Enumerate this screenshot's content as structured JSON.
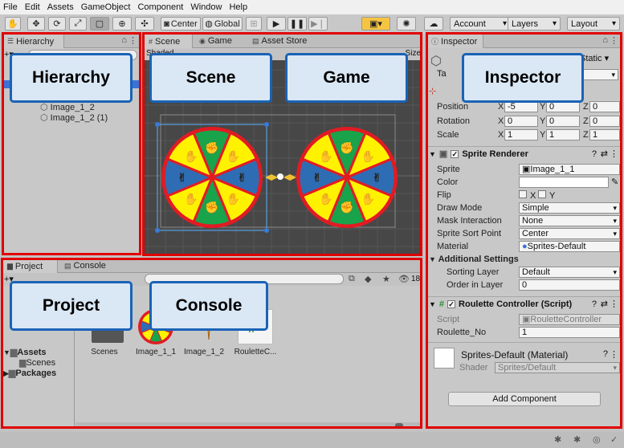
{
  "menu": [
    "File",
    "Edit",
    "Assets",
    "GameObject",
    "Component",
    "Window",
    "Help"
  ],
  "toolbar": {
    "center_label": "Center",
    "global_label": "Global",
    "account_label": "Account",
    "layers_label": "Layers",
    "layout_label": "Layout"
  },
  "hierarchy": {
    "tab": "Hierarchy",
    "items": [
      "Image_1_2",
      "Image_1_2 (1)"
    ]
  },
  "scene_tabs": {
    "scene": "Scene",
    "game": "Game",
    "asset_store": "Asset Store",
    "toolbar_partial": "Shaded",
    "size_partial": "Size"
  },
  "inspector": {
    "tab": "Inspector",
    "static_label": "Static",
    "tag_partial": "Ta",
    "layer_partial": "ult",
    "transform": {
      "position_label": "Position",
      "position": {
        "x": "-5",
        "y": "0",
        "z": "0"
      },
      "rotation_label": "Rotation",
      "rotation": {
        "x": "0",
        "y": "0",
        "z": "0"
      },
      "scale_label": "Scale",
      "scale": {
        "x": "1",
        "y": "1",
        "z": "1"
      }
    },
    "sprite_renderer": {
      "title": "Sprite Renderer",
      "sprite_label": "Sprite",
      "sprite_value": "Image_1_1",
      "color_label": "Color",
      "flip_label": "Flip",
      "flip_x": "X",
      "flip_y": "Y",
      "draw_mode_label": "Draw Mode",
      "draw_mode_value": "Simple",
      "mask_label": "Mask Interaction",
      "mask_value": "None",
      "sort_point_label": "Sprite Sort Point",
      "sort_point_value": "Center",
      "material_label": "Material",
      "material_value": "Sprites-Default",
      "additional_label": "Additional Settings",
      "sorting_layer_label": "Sorting Layer",
      "sorting_layer_value": "Default",
      "order_label": "Order in Layer",
      "order_value": "0"
    },
    "roulette": {
      "title": "Roulette Controller (Script)",
      "script_label": "Script",
      "script_value": "RouletteController",
      "no_label": "Roulette_No",
      "no_value": "1"
    },
    "material": {
      "title": "Sprites-Default (Material)",
      "shader_label": "Shader",
      "shader_value": "Sprites/Default"
    },
    "add_component": "Add Component"
  },
  "project": {
    "tab_project": "Project",
    "tab_console": "Console",
    "tree": [
      "Assets",
      "Scenes",
      "Packages"
    ],
    "assets": [
      "Scenes",
      "Image_1_1",
      "Image_1_2",
      "RouletteC..."
    ],
    "count_badge": "18"
  },
  "callouts": {
    "hierarchy": "Hierarchy",
    "scene": "Scene",
    "game": "Game",
    "inspector": "Inspector",
    "project": "Project",
    "console": "Console"
  },
  "colors": {
    "highlight_red": "#e00000",
    "callout_border": "#1a63b5",
    "callout_fill": "#dae7f4",
    "wheel_red": "#e21b23",
    "wheel_yellow": "#fff200",
    "wheel_green": "#19a34a",
    "wheel_blue": "#2e6db4"
  }
}
